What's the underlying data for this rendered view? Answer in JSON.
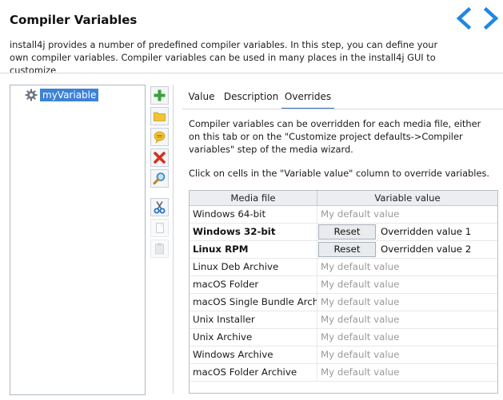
{
  "header": {
    "title": "Compiler Variables",
    "description": "install4j provides a number of predefined compiler variables. In this step, you can define your own compiler variables. Compiler variables can be used in many places in the install4j GUI to customize",
    "nav_colors": {
      "accent": "#1e88e5"
    }
  },
  "tree": {
    "items": [
      {
        "label": "myVariable",
        "icon": "gear-icon"
      }
    ]
  },
  "toolbar": {
    "buttons": [
      {
        "name": "add-icon",
        "enabled": true
      },
      {
        "name": "folder-icon",
        "enabled": true
      },
      {
        "name": "comment-icon",
        "enabled": true
      },
      {
        "name": "delete-icon",
        "enabled": true
      },
      {
        "name": "search-icon",
        "enabled": true
      },
      {
        "name": "cut-icon",
        "enabled": true
      },
      {
        "name": "copy-icon",
        "enabled": false
      },
      {
        "name": "paste-icon",
        "enabled": false
      }
    ]
  },
  "tabs": [
    {
      "label": "Value",
      "active": false
    },
    {
      "label": "Description",
      "active": false
    },
    {
      "label": "Overrides",
      "active": true
    }
  ],
  "overrides": {
    "info": "Compiler variables can be overridden for each media file, either on this tab or on the \"Customize project defaults->Compiler variables\" step of the media wizard.",
    "hint": "Click on cells in the \"Variable value\" column to override variables.",
    "table": {
      "columns": [
        "Media file",
        "Variable value"
      ],
      "rows": [
        {
          "media": "Windows 64-bit",
          "value": "My default value",
          "overridden": false
        },
        {
          "media": "Windows 32-bit",
          "reset_label": "Reset",
          "value": "Overridden value 1",
          "overridden": true
        },
        {
          "media": "Linux RPM",
          "reset_label": "Reset",
          "value": "Overridden value 2",
          "overridden": true
        },
        {
          "media": "Linux Deb Archive",
          "value": "My default value",
          "overridden": false
        },
        {
          "media": "macOS Folder",
          "value": "My default value",
          "overridden": false
        },
        {
          "media": "macOS Single Bundle Archi...",
          "value": "My default value",
          "overridden": false
        },
        {
          "media": "Unix Installer",
          "value": "My default value",
          "overridden": false
        },
        {
          "media": "Unix Archive",
          "value": "My default value",
          "overridden": false
        },
        {
          "media": "Windows Archive",
          "value": "My default value",
          "overridden": false
        },
        {
          "media": "macOS Folder Archive",
          "value": "My default value",
          "overridden": false
        }
      ]
    }
  }
}
